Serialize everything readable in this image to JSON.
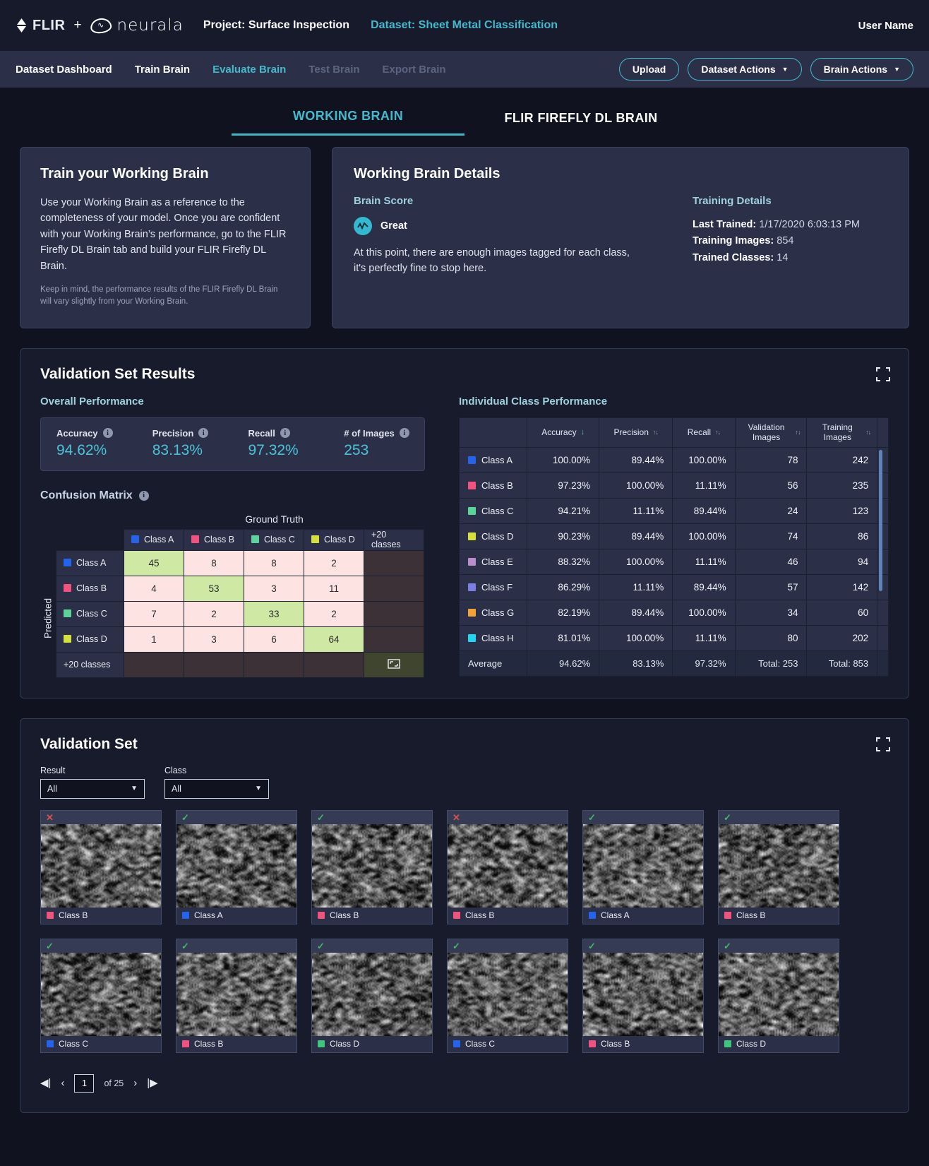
{
  "topbar": {
    "brand_flir": "FLIR",
    "plus": "+",
    "brand_neurala": "neurala",
    "project": "Project: Surface Inspection",
    "dataset": "Dataset: Sheet Metal Classification",
    "user": "User Name"
  },
  "nav": {
    "items": [
      {
        "label": "Dataset Dashboard",
        "state": "normal"
      },
      {
        "label": "Train Brain",
        "state": "normal"
      },
      {
        "label": "Evaluate Brain",
        "state": "active"
      },
      {
        "label": "Test Brain",
        "state": "disabled"
      },
      {
        "label": "Export Brain",
        "state": "disabled"
      }
    ],
    "upload": "Upload",
    "dataset_actions": "Dataset Actions",
    "brain_actions": "Brain Actions",
    "caret": "▼"
  },
  "brain_tabs": [
    {
      "label": "WORKING BRAIN",
      "active": true
    },
    {
      "label": "FLIR FIREFLY DL BRAIN",
      "active": false
    }
  ],
  "train_card": {
    "title": "Train your Working Brain",
    "body": "Use your Working Brain as a reference to the completeness of your model. Once you are confident with your Working Brain’s performance, go to the FLIR Firefly DL Brain tab and build your FLIR Firefly DL Brain.",
    "note": "Keep in mind, the performance results of the FLIR Firefly DL Brain will vary slightly from your Working Brain."
  },
  "details_card": {
    "title": "Working Brain Details",
    "brain_score_heading": "Brain Score",
    "score_label": "Great",
    "score_desc": "At this point, there are enough images tagged for each class, it's perfectly fine to stop here.",
    "training_heading": "Training Details",
    "last_trained_key": "Last Trained:",
    "last_trained_value": "1/17/2020 6:03:13 PM",
    "training_images_key": "Training Images:",
    "training_images_value": "854",
    "trained_classes_key": "Trained Classes:",
    "trained_classes_value": "14"
  },
  "results": {
    "title": "Validation Set Results",
    "overall_heading": "Overall Performance",
    "metrics": [
      {
        "label": "Accuracy",
        "value": "94.62%"
      },
      {
        "label": "Precision",
        "value": "83.13%"
      },
      {
        "label": "Recall",
        "value": "97.32%"
      },
      {
        "label": "# of Images",
        "value": "253"
      }
    ],
    "confusion_title": "Confusion Matrix",
    "ground_truth_label": "Ground Truth",
    "predicted_label": "Predicted",
    "more_classes": "+20 classes",
    "class_perf_heading": "Individual Class Performance"
  },
  "chart_data": {
    "type": "heatmap",
    "title": "Confusion Matrix",
    "xlabel": "Ground Truth",
    "ylabel": "Predicted",
    "categories": [
      "Class A",
      "Class B",
      "Class C",
      "Class D"
    ],
    "extra_category": "+20 classes",
    "colors": [
      "#2563eb",
      "#f2527f",
      "#5bd39a",
      "#d6e03a"
    ],
    "matrix": [
      [
        45,
        8,
        8,
        2
      ],
      [
        4,
        53,
        3,
        11
      ],
      [
        7,
        2,
        33,
        2
      ],
      [
        1,
        3,
        6,
        64
      ]
    ],
    "diagonal_color": "#cfe8a4",
    "offdiagonal_color": "#fde4e2"
  },
  "class_table": {
    "columns": [
      "",
      "Accuracy",
      "Precision",
      "Recall",
      "Validation Images",
      "Training Images"
    ],
    "sort_indicators": [
      "",
      "↓",
      "↑↓",
      "↑↓",
      "↑↓",
      "↑↓"
    ],
    "rows": [
      {
        "name": "Class A",
        "color": "#2563eb",
        "accuracy": "100.00%",
        "precision": "89.44%",
        "recall": "100.00%",
        "validation": "78",
        "training": "242"
      },
      {
        "name": "Class B",
        "color": "#f2527f",
        "accuracy": "97.23%",
        "precision": "100.00%",
        "recall": "11.11%",
        "validation": "56",
        "training": "235"
      },
      {
        "name": "Class C",
        "color": "#5bd39a",
        "accuracy": "94.21%",
        "precision": "11.11%",
        "recall": "89.44%",
        "validation": "24",
        "training": "123"
      },
      {
        "name": "Class D",
        "color": "#d6e03a",
        "accuracy": "90.23%",
        "precision": "89.44%",
        "recall": "100.00%",
        "validation": "74",
        "training": "86"
      },
      {
        "name": "Class E",
        "color": "#b98ecb",
        "accuracy": "88.32%",
        "precision": "100.00%",
        "recall": "11.11%",
        "validation": "46",
        "training": "94"
      },
      {
        "name": "Class F",
        "color": "#7b7fe0",
        "accuracy": "86.29%",
        "precision": "11.11%",
        "recall": "89.44%",
        "validation": "57",
        "training": "142"
      },
      {
        "name": "Class G",
        "color": "#f0a33c",
        "accuracy": "82.19%",
        "precision": "89.44%",
        "recall": "100.00%",
        "validation": "34",
        "training": "60"
      },
      {
        "name": "Class H",
        "color": "#23d6f0",
        "accuracy": "81.01%",
        "precision": "100.00%",
        "recall": "11.11%",
        "validation": "80",
        "training": "202"
      }
    ],
    "average": {
      "name": "Average",
      "accuracy": "94.62%",
      "precision": "83.13%",
      "recall": "97.32%",
      "validation": "Total: 253",
      "training": "Total: 853"
    }
  },
  "validation_set": {
    "title": "Validation Set",
    "result_filter_label": "Result",
    "result_filter_value": "All",
    "class_filter_label": "Class",
    "class_filter_value": "All",
    "thumbnails": [
      {
        "result": "bad",
        "class": "Class B",
        "color": "#f2527f",
        "seed": 1
      },
      {
        "result": "ok",
        "class": "Class A",
        "color": "#2563eb",
        "seed": 2
      },
      {
        "result": "ok",
        "class": "Class B",
        "color": "#f2527f",
        "seed": 3
      },
      {
        "result": "bad",
        "class": "Class B",
        "color": "#f2527f",
        "seed": 4
      },
      {
        "result": "ok",
        "class": "Class A",
        "color": "#2563eb",
        "seed": 5
      },
      {
        "result": "ok",
        "class": "Class B",
        "color": "#f2527f",
        "seed": 6
      },
      {
        "result": "ok",
        "class": "Class C",
        "color": "#2563eb",
        "seed": 7
      },
      {
        "result": "ok",
        "class": "Class B",
        "color": "#f2527f",
        "seed": 8
      },
      {
        "result": "ok",
        "class": "Class D",
        "color": "#3cc878",
        "seed": 9
      },
      {
        "result": "ok",
        "class": "Class C",
        "color": "#2563eb",
        "seed": 10
      },
      {
        "result": "ok",
        "class": "Class B",
        "color": "#f2527f",
        "seed": 11
      },
      {
        "result": "ok",
        "class": "Class D",
        "color": "#3cc878",
        "seed": 12
      }
    ],
    "mark_ok": "✓",
    "mark_bad": "✕",
    "pager": {
      "first": "◀|",
      "prev": "‹",
      "page": "1",
      "of": "of 25",
      "next": "›",
      "last": "|▶"
    }
  },
  "colors": {
    "accent": "#43b9cc",
    "panel": "#2b3048",
    "background": "#10131f"
  }
}
